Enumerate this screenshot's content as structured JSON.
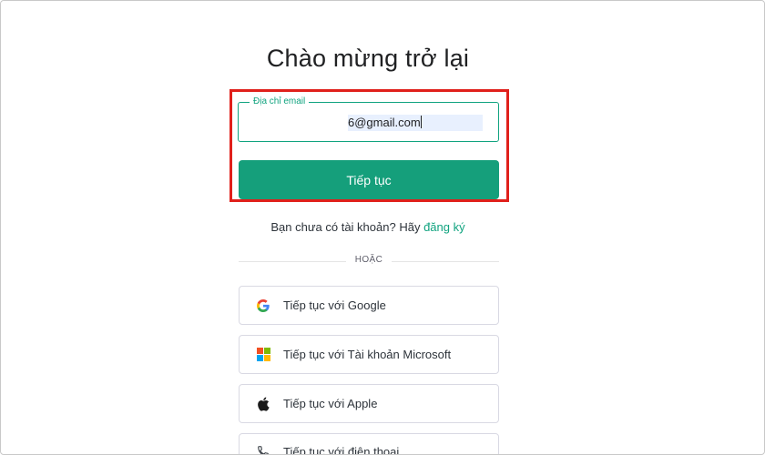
{
  "heading": "Chào mừng trở lại",
  "email": {
    "label": "Địa chỉ email",
    "value": "6@gmail.com"
  },
  "continue_button": "Tiếp tục",
  "signup": {
    "prompt": "Bạn chưa có tài khoản? Hãy",
    "link": "đăng ký"
  },
  "divider_text": "HOẶC",
  "social_buttons": [
    {
      "label": "Tiếp tục với Google",
      "icon": "google-icon"
    },
    {
      "label": "Tiếp tục với Tài khoản Microsoft",
      "icon": "microsoft-icon"
    },
    {
      "label": "Tiếp tục với Apple",
      "icon": "apple-icon"
    },
    {
      "label": "Tiếp tục với điện thoại",
      "icon": "phone-icon"
    }
  ],
  "colors": {
    "accent": "#10a37f",
    "button": "#159f7b",
    "highlight_border": "#e0201b"
  }
}
